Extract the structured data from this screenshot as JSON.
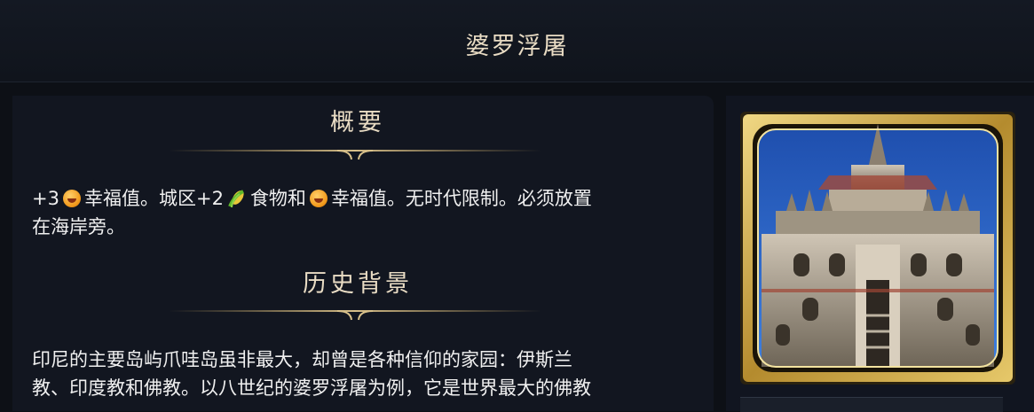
{
  "header": {
    "title": "婆罗浮屠"
  },
  "overview": {
    "heading": "概要",
    "seg1": "+3",
    "seg2": "幸福值。城区+2",
    "seg3": "食物和",
    "seg4": "幸福值。无时代限制。必须放置",
    "seg5": "在海岸旁。",
    "icons": [
      "amenity-icon",
      "food-icon",
      "amenity-icon"
    ]
  },
  "history": {
    "heading": "历史背景",
    "line1": "印尼的主要岛屿爪哇岛虽非最大，却曾是各种信仰的家园：伊斯兰",
    "line2": "教、印度教和佛教。以八世纪的婆罗浮屠为例，它是世界最大的佛教"
  },
  "portrait": {
    "icon": "borobudur-wonder-icon",
    "frame_color": "#c9a64a",
    "sky_color": "#2a5fbf"
  }
}
